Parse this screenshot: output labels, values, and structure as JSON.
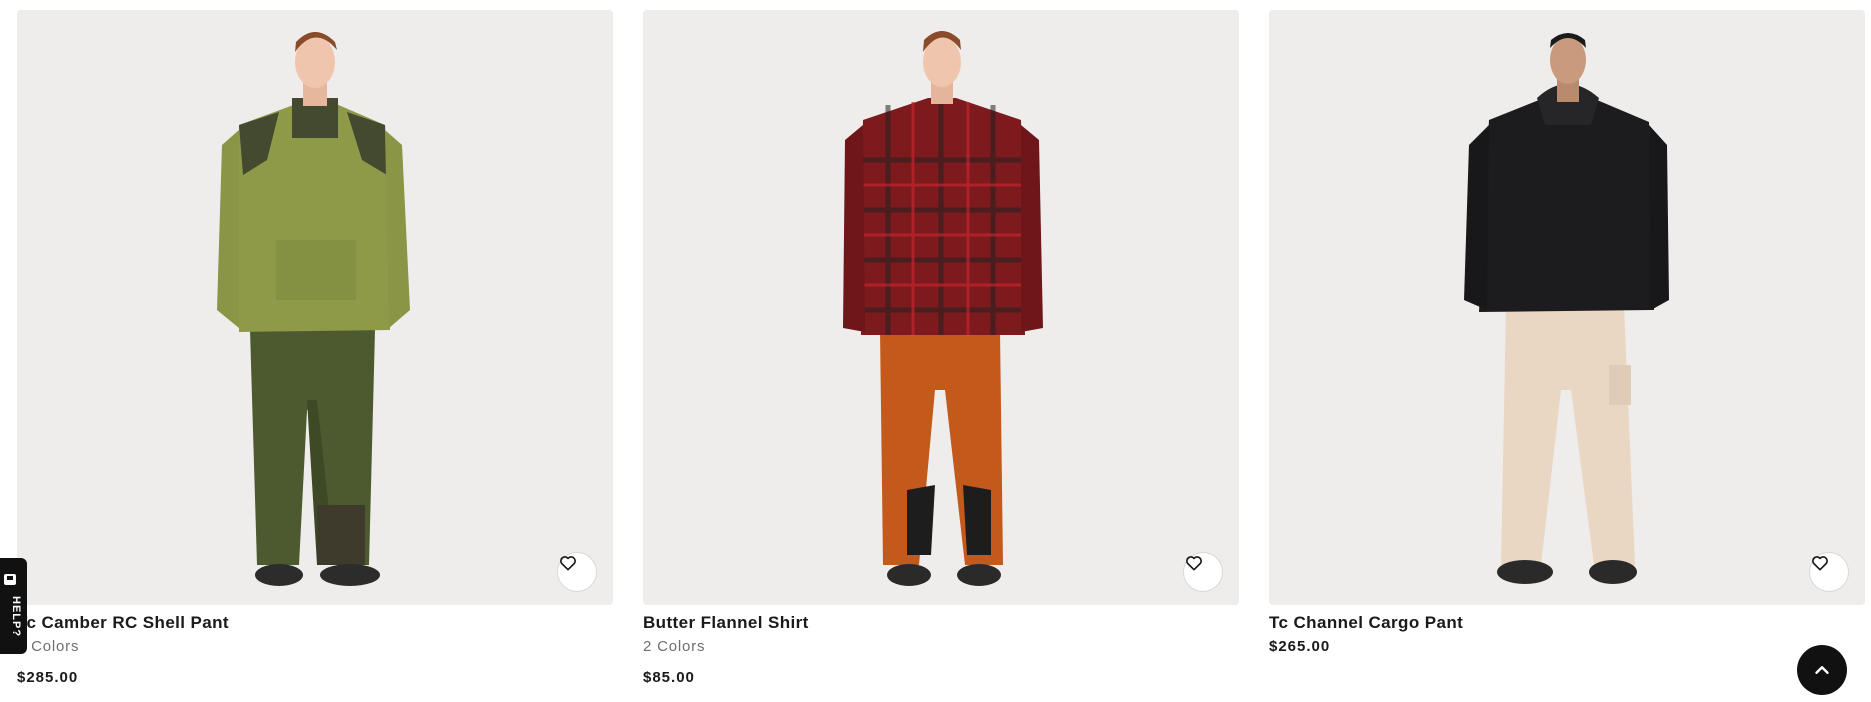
{
  "products": [
    {
      "name": "Tc Camber RC Shell Pant",
      "colors": "2 Colors",
      "price": "$285.00"
    },
    {
      "name": "Butter Flannel Shirt",
      "colors": "2 Colors",
      "price": "$85.00"
    },
    {
      "name": "Tc Channel Cargo Pant",
      "price": "$265.00"
    }
  ],
  "help_tab": {
    "label": "HELP?"
  },
  "icons": {
    "favorite": "heart-outline-icon",
    "back_to_top": "chevron-up-icon",
    "help": "chat-icon"
  },
  "colors": {
    "image_background": "#efedec",
    "text": "#1a1a1a",
    "muted_text": "#6f6f6f",
    "dark_button": "#111111"
  }
}
